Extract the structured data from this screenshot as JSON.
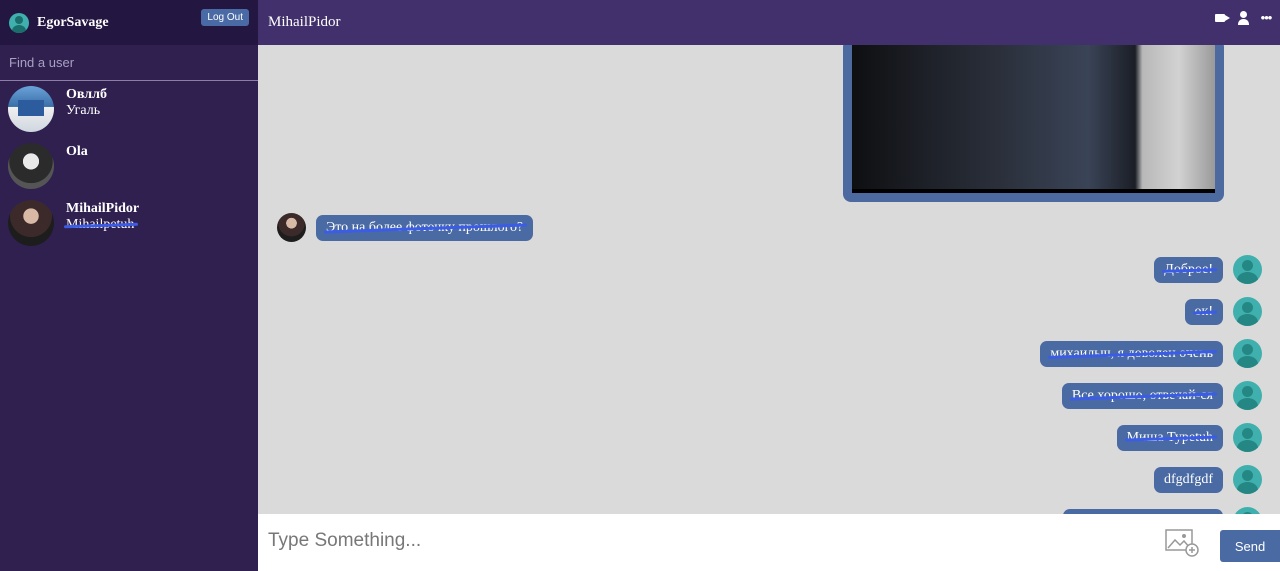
{
  "sidebar": {
    "current_user": "EgorSavage",
    "logout_label": "Log Out",
    "search_placeholder": "Find a user",
    "contacts": [
      {
        "name": "Овллб",
        "last_message": "Угаль"
      },
      {
        "name": "Ola",
        "last_message": ""
      },
      {
        "name": "MihailPidor",
        "last_message": "Mihailpetuh"
      }
    ]
  },
  "header": {
    "chat_title": "MihailPidor",
    "icons": [
      "video-camera-icon",
      "add-user-icon",
      "more-icon"
    ]
  },
  "messages": [
    {
      "direction": "in",
      "text": "Это на более фоточку прошлого?"
    },
    {
      "direction": "out",
      "text": "Доброе!"
    },
    {
      "direction": "out",
      "text": "ок!"
    },
    {
      "direction": "out",
      "text": "михаилыч, я доволен очень"
    },
    {
      "direction": "out",
      "text": "Все хорошо, отвечай-ся"
    },
    {
      "direction": "out",
      "text": "Миша Туpetuh"
    },
    {
      "direction": "out",
      "text": "dfgdfgdf"
    }
  ],
  "composer": {
    "placeholder": "Type Something...",
    "send_label": "Send"
  },
  "colors": {
    "sidebar_bg": "#2f2050",
    "topbar_bg": "#41306b",
    "bubble": "#4a6aa3",
    "chat_bg": "#dadada"
  }
}
